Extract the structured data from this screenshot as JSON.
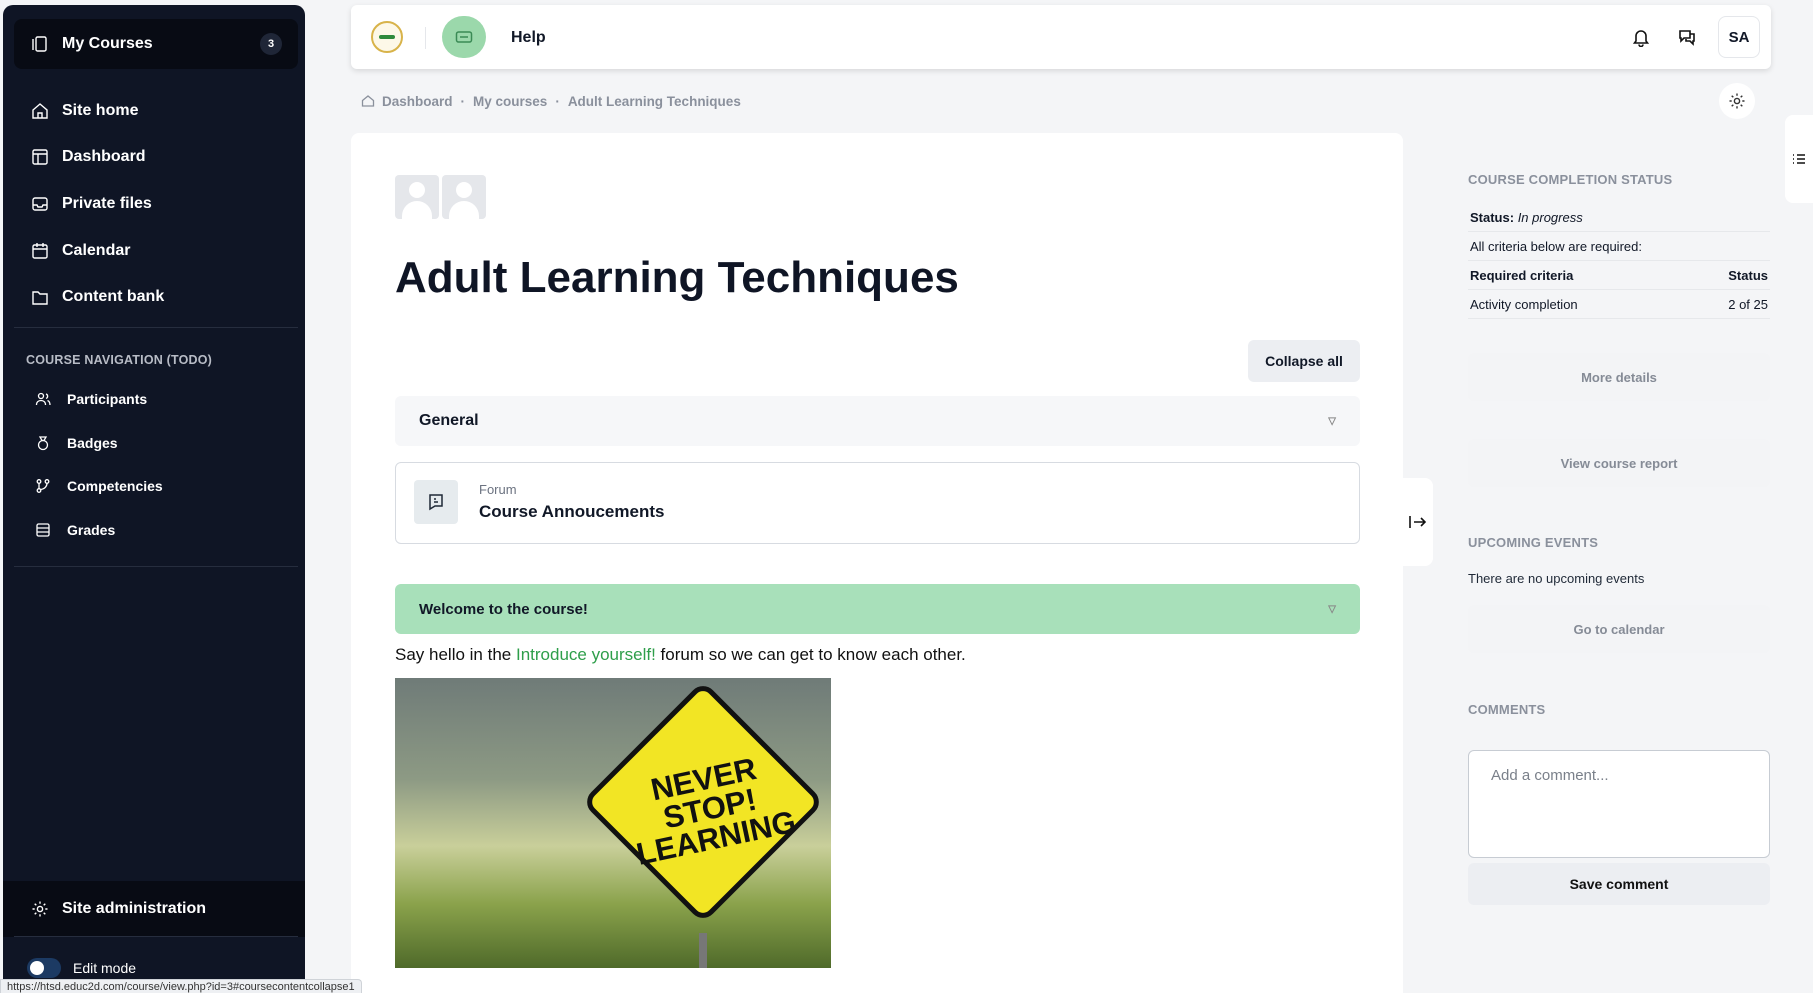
{
  "sidebar": {
    "my_courses": {
      "label": "My Courses",
      "count": "3"
    },
    "items": [
      {
        "label": "Site home",
        "icon": "home-icon"
      },
      {
        "label": "Dashboard",
        "icon": "dashboard-icon"
      },
      {
        "label": "Private files",
        "icon": "inbox-icon"
      },
      {
        "label": "Calendar",
        "icon": "calendar-icon"
      },
      {
        "label": "Content bank",
        "icon": "folder-icon"
      }
    ],
    "course_nav_heading": "COURSE NAVIGATION (TODO)",
    "course_nav": [
      {
        "label": "Participants",
        "icon": "users-icon"
      },
      {
        "label": "Badges",
        "icon": "badge-icon"
      },
      {
        "label": "Competencies",
        "icon": "competencies-icon"
      },
      {
        "label": "Grades",
        "icon": "grades-icon"
      }
    ],
    "site_admin": "Site administration",
    "edit_mode": "Edit mode"
  },
  "topbar": {
    "help": "Help",
    "avatar_initials": "SA"
  },
  "breadcrumb": [
    "Dashboard",
    "My courses",
    "Adult Learning Techniques"
  ],
  "main": {
    "title": "Adult Learning Techniques",
    "collapse_all": "Collapse all",
    "section_general": "General",
    "activity_type": "Forum",
    "activity_name": "Course Annoucements",
    "section_welcome": "Welcome to the course!",
    "intro_before": "Say hello in the ",
    "intro_link": "Introduce yourself!",
    "intro_after": " forum so we can get to know each other.",
    "image_sign_text": "NEVER STOP! LEARNING"
  },
  "right": {
    "completion_heading": "COURSE COMPLETION STATUS",
    "status_label": "Status:",
    "status_value": "In progress",
    "criteria_note": "All criteria below are required:",
    "col_criteria": "Required criteria",
    "col_status": "Status",
    "row_criteria": "Activity completion",
    "row_status": "2 of 25",
    "more_details": "More details",
    "view_report": "View course report",
    "events_heading": "UPCOMING EVENTS",
    "no_events": "There are no upcoming events",
    "go_calendar": "Go to calendar",
    "comments_heading": "COMMENTS",
    "comment_placeholder": "Add a comment...",
    "save_comment": "Save comment"
  },
  "statusbar_url": "https://htsd.educ2d.com/course/view.php?id=3#coursecontentcollapse1",
  "colors": {
    "sidebar_bg": "#0f1525",
    "accent_green": "#a8e0ba",
    "link_green": "#2e9e4a"
  }
}
